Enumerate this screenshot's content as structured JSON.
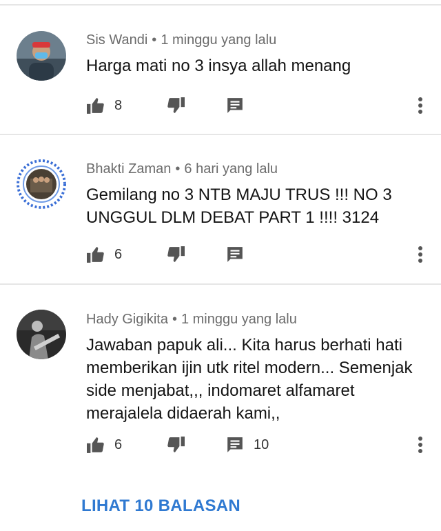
{
  "comments": [
    {
      "author": "Sis Wandi",
      "time": "1 minggu yang lalu",
      "text": "Harga mati no 3 insya allah menang",
      "likes": "8",
      "replies": ""
    },
    {
      "author": "Bhakti Zaman",
      "time": "6 hari yang lalu",
      "text": "Gemilang no 3 NTB MAJU TRUS !!! NO 3 UNGGUL DLM DEBAT PART 1 !!!! 3124",
      "likes": "6",
      "replies": ""
    },
    {
      "author": "Hady Gigikita",
      "time": "1 minggu yang lalu",
      "text": "Jawaban papuk ali... Kita harus berhati hati memberikan ijin utk ritel modern... Semenjak side menjabat,,, indomaret alfamaret merajalela didaerah kami,,",
      "likes": "6",
      "replies": "10"
    }
  ],
  "meta_separator": "•",
  "view_replies_label": "LIHAT 10 BALASAN",
  "colors": {
    "link": "#2f79d1",
    "icon": "#555555",
    "divider": "#e6e6e6"
  }
}
